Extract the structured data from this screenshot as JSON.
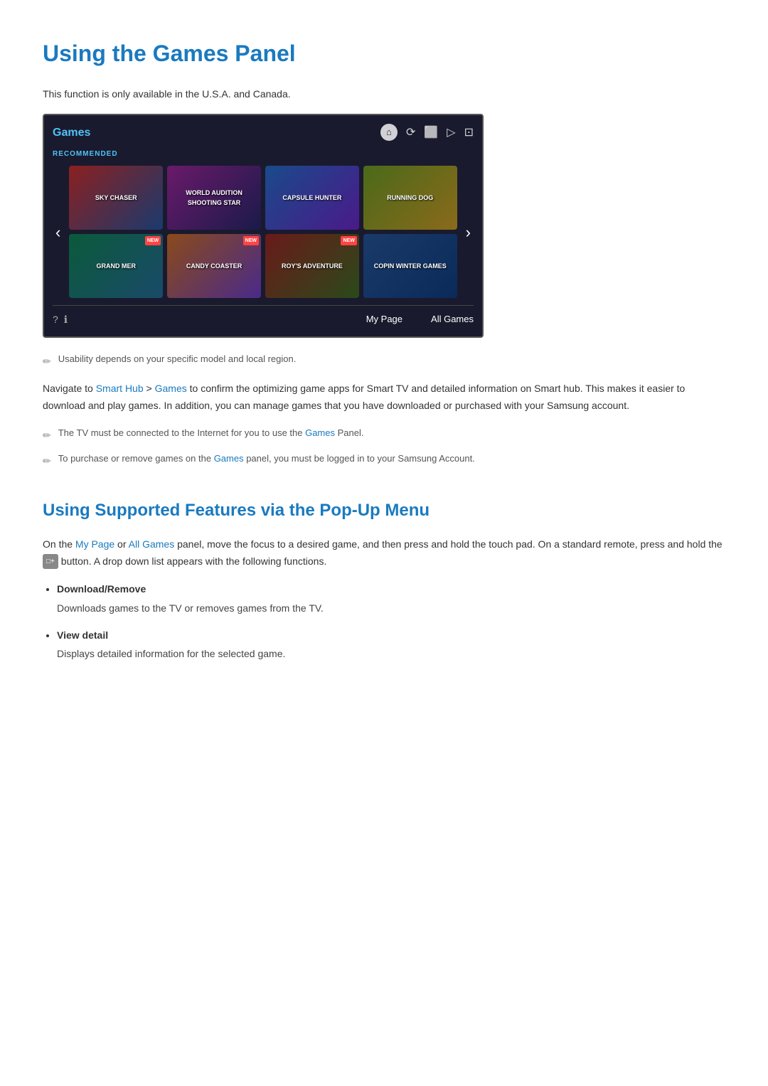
{
  "page": {
    "title": "Using the Games Panel",
    "subtitle": "Using Supported Features via the Pop-Up Menu",
    "intro": "This function is only available in the U.S.A. and Canada.",
    "note1": "Usability depends on your specific model and local region.",
    "body1": "Navigate to Smart Hub > Games to confirm the optimizing game apps for Smart TV and detailed information on Smart hub. This makes it easier to download and play games. In addition, you can manage games that you have downloaded or purchased with your Samsung account.",
    "note2": "The TV must be connected to the Internet for you to use the Games Panel.",
    "note3": "To purchase or remove games on the Games panel, you must be logged in to your Samsung Account.",
    "popup_intro": "On the My Page or All Games panel, move the focus to a desired game, and then press and hold the touch pad. On a standard remote, press and hold the",
    "popup_intro2": "button. A drop down list appears with the following functions.",
    "smart_hub_link": "Smart Hub",
    "games_link": "Games",
    "my_page_link": "My Page",
    "all_games_link": "All Games",
    "games_link2": "Games",
    "games_link3": "Games",
    "panel": {
      "title": "Games",
      "recommended_label": "RECOMMENDED",
      "footer_items": [
        "My Page",
        "All Games"
      ],
      "games": [
        {
          "title": "SKY CHASER",
          "new": false
        },
        {
          "title": "WORLD AUDITION SHOOTING STAR",
          "new": false
        },
        {
          "title": "CAPSULE HUNTER",
          "new": false
        },
        {
          "title": "RUNNING DOG",
          "new": false
        },
        {
          "title": "GRAND MER",
          "new": true
        },
        {
          "title": "CANDY COASTER",
          "new": true
        },
        {
          "title": "ROY'S ADVENTURE",
          "new": true
        },
        {
          "title": "COPIN WINTER GAMES",
          "new": false
        }
      ]
    },
    "features": [
      {
        "title": "Download/Remove",
        "description": "Downloads games to the TV or removes games from the TV."
      },
      {
        "title": "View detail",
        "description": "Displays detailed information for the selected game."
      }
    ]
  }
}
